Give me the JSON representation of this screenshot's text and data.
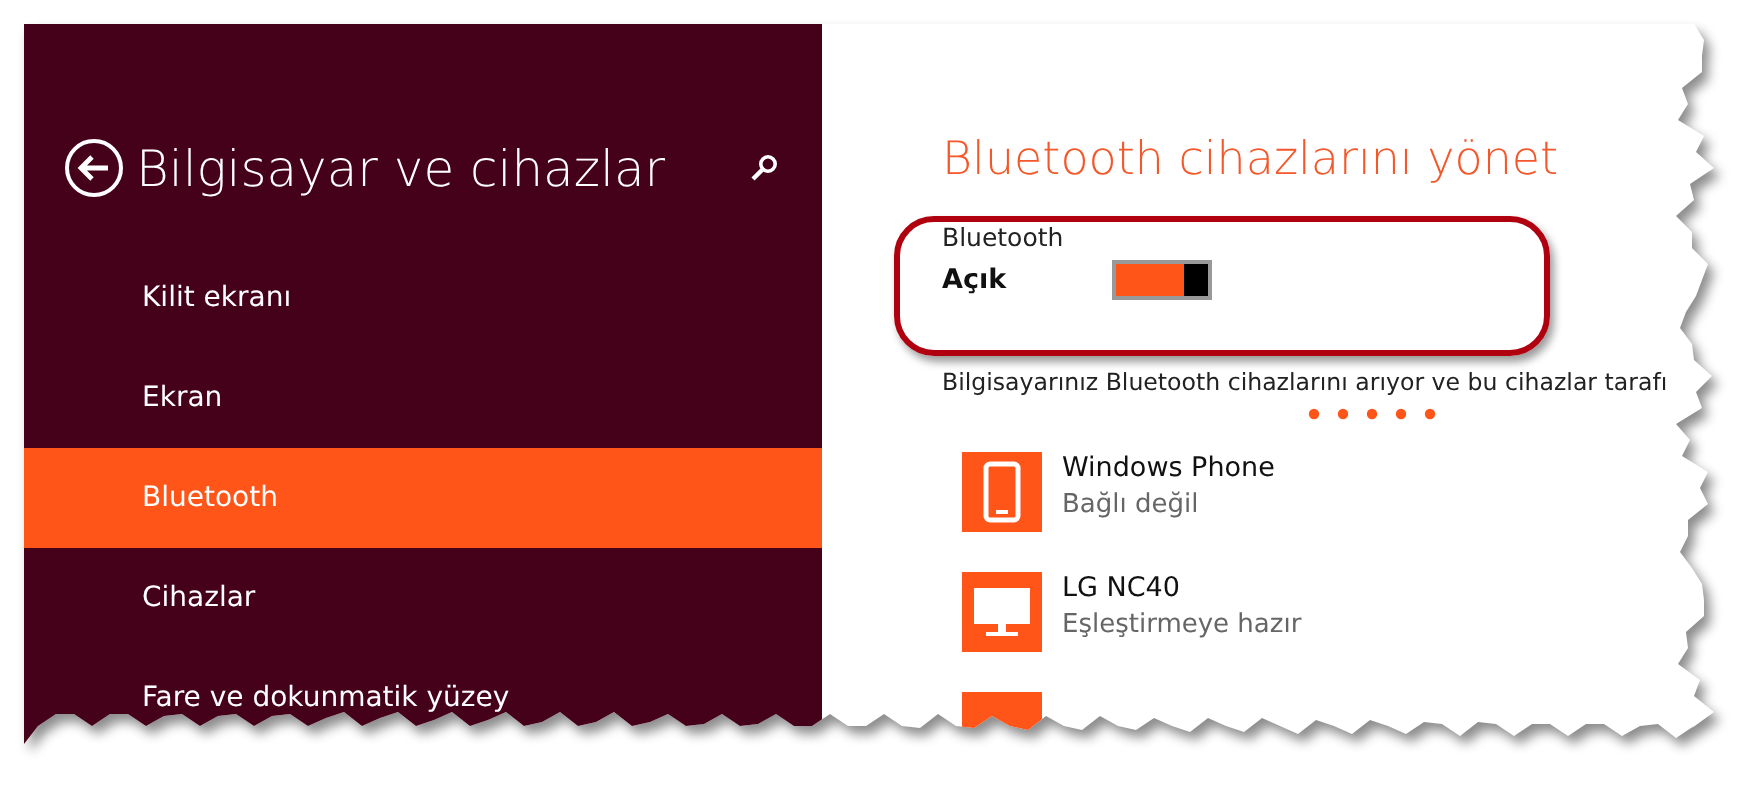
{
  "sidebar": {
    "title": "Bilgisayar ve cihazlar",
    "items": [
      {
        "label": "Kilit ekranı",
        "selected": false
      },
      {
        "label": "Ekran",
        "selected": false
      },
      {
        "label": "Bluetooth",
        "selected": true
      },
      {
        "label": "Cihazlar",
        "selected": false
      },
      {
        "label": "Fare ve dokunmatik yüzey",
        "selected": false
      }
    ]
  },
  "content": {
    "heading": "Bluetooth cihazlarını yönet",
    "bluetooth": {
      "label": "Bluetooth",
      "state": "Açık",
      "on": true
    },
    "description": "Bilgisayarınız Bluetooth cihazlarını arıyor ve bu cihazlar tarafı",
    "devices": [
      {
        "kind": "phone",
        "name": "Windows Phone",
        "status": "Bağlı değil"
      },
      {
        "kind": "monitor",
        "name": "LG NC40",
        "status": "Eşleştirmeye hazır"
      },
      {
        "kind": "cut"
      }
    ]
  }
}
